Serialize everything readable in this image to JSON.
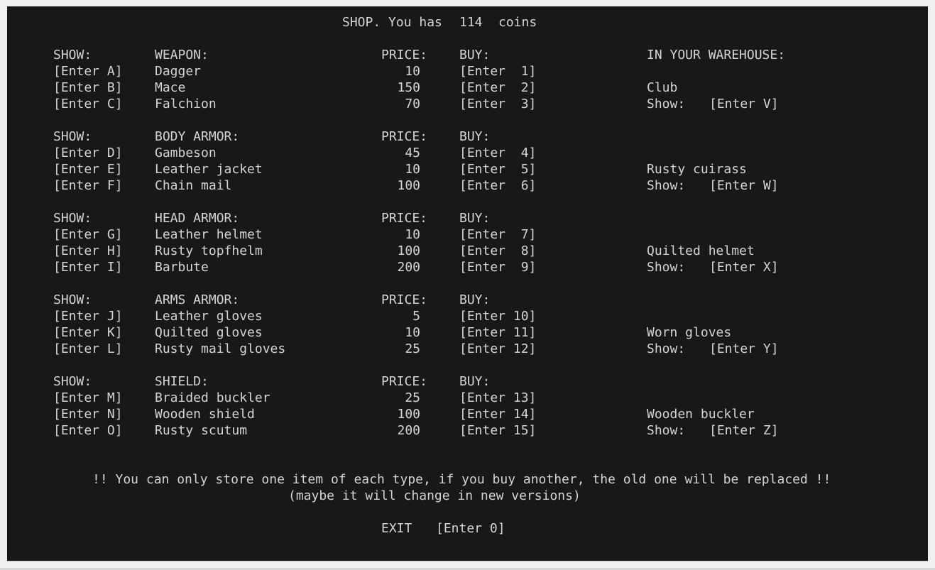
{
  "title": {
    "prefix": "SHOP. You has",
    "coins": "114",
    "suffix": "coins"
  },
  "warehouse_header": "IN YOUR WAREHOUSE:",
  "sections": [
    {
      "show_header": "SHOW:",
      "category": "WEAPON:",
      "price_header": "PRICE:",
      "buy_header": "BUY:",
      "items": [
        {
          "show": "[Enter A]",
          "name": "Dagger",
          "price": "10",
          "buy": "[Enter  1]"
        },
        {
          "show": "[Enter B]",
          "name": "Mace",
          "price": "150",
          "buy": "[Enter  2]"
        },
        {
          "show": "[Enter C]",
          "name": "Falchion",
          "price": "70",
          "buy": "[Enter  3]"
        }
      ],
      "warehouse": {
        "item": "Club",
        "show_label": "Show:",
        "show_key": "[Enter V]"
      }
    },
    {
      "show_header": "SHOW:",
      "category": "BODY ARMOR:",
      "price_header": "PRICE:",
      "buy_header": "BUY:",
      "items": [
        {
          "show": "[Enter D]",
          "name": "Gambeson",
          "price": "45",
          "buy": "[Enter  4]"
        },
        {
          "show": "[Enter E]",
          "name": "Leather jacket",
          "price": "10",
          "buy": "[Enter  5]"
        },
        {
          "show": "[Enter F]",
          "name": "Chain mail",
          "price": "100",
          "buy": "[Enter  6]"
        }
      ],
      "warehouse": {
        "item": "Rusty cuirass",
        "show_label": "Show:",
        "show_key": "[Enter W]"
      }
    },
    {
      "show_header": "SHOW:",
      "category": "HEAD ARMOR:",
      "price_header": "PRICE:",
      "buy_header": "BUY:",
      "items": [
        {
          "show": "[Enter G]",
          "name": "Leather helmet",
          "price": "10",
          "buy": "[Enter  7]"
        },
        {
          "show": "[Enter H]",
          "name": "Rusty topfhelm",
          "price": "100",
          "buy": "[Enter  8]"
        },
        {
          "show": "[Enter I]",
          "name": "Barbute",
          "price": "200",
          "buy": "[Enter  9]"
        }
      ],
      "warehouse": {
        "item": "Quilted helmet",
        "show_label": "Show:",
        "show_key": "[Enter X]"
      }
    },
    {
      "show_header": "SHOW:",
      "category": "ARMS ARMOR:",
      "price_header": "PRICE:",
      "buy_header": "BUY:",
      "items": [
        {
          "show": "[Enter J]",
          "name": "Leather gloves",
          "price": "5",
          "buy": "[Enter 10]"
        },
        {
          "show": "[Enter K]",
          "name": "Quilted gloves",
          "price": "10",
          "buy": "[Enter 11]"
        },
        {
          "show": "[Enter L]",
          "name": "Rusty mail gloves",
          "price": "25",
          "buy": "[Enter 12]"
        }
      ],
      "warehouse": {
        "item": "Worn gloves",
        "show_label": "Show:",
        "show_key": "[Enter Y]"
      }
    },
    {
      "show_header": "SHOW:",
      "category": "SHIELD:",
      "price_header": "PRICE:",
      "buy_header": "BUY:",
      "items": [
        {
          "show": "[Enter M]",
          "name": "Braided buckler",
          "price": "25",
          "buy": "[Enter 13]"
        },
        {
          "show": "[Enter N]",
          "name": "Wooden shield",
          "price": "100",
          "buy": "[Enter 14]"
        },
        {
          "show": "[Enter O]",
          "name": "Rusty scutum",
          "price": "200",
          "buy": "[Enter 15]"
        }
      ],
      "warehouse": {
        "item": "Wooden buckler",
        "show_label": "Show:",
        "show_key": "[Enter Z]"
      }
    }
  ],
  "notice": {
    "line1": "!! You can only store one item of each type, if you buy another, the old one will be replaced !!",
    "line2": "(maybe it will change in new versions)"
  },
  "exit": {
    "label": "EXIT",
    "key": "[Enter 0]"
  }
}
